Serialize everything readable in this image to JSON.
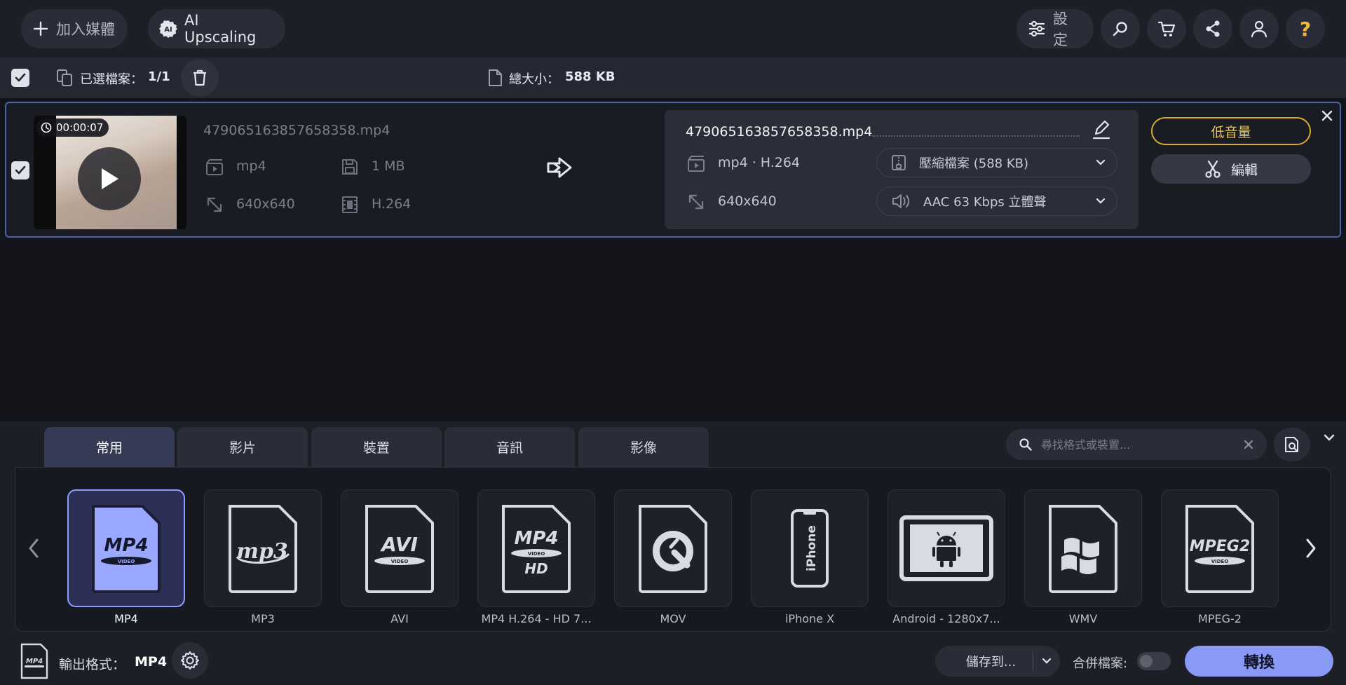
{
  "topbar": {
    "add_media": "加入媒體",
    "ai_upscaling": "AI Upscaling",
    "ai_badge": "AI",
    "settings": "設定",
    "help_glyph": "?"
  },
  "selection": {
    "label": "已選檔案：",
    "count": "1/1",
    "total_label": "總大小：",
    "total_value": "588 KB"
  },
  "file": {
    "duration": "00:00:07",
    "name": "479065163857658358.mp4",
    "format": "mp4",
    "size": "1 MB",
    "resolution": "640x640",
    "codec": "H.264"
  },
  "output": {
    "name": "479065163857658358.mp4",
    "format": "mp4 · H.264",
    "resolution": "640x640",
    "compress": "壓縮檔案 (588 KB)",
    "audio": "AAC 63 Kbps 立體聲",
    "low_volume": "低音量",
    "edit": "編輯"
  },
  "tabs": [
    {
      "label": "常用"
    },
    {
      "label": "影片"
    },
    {
      "label": "裝置"
    },
    {
      "label": "音訊"
    },
    {
      "label": "影像"
    }
  ],
  "search": {
    "placeholder": "尋找格式或裝置..."
  },
  "formats": [
    {
      "label": "MP4",
      "icon": "MP4",
      "sub": "VIDEO"
    },
    {
      "label": "MP3",
      "icon": "mp3"
    },
    {
      "label": "AVI",
      "icon": "AVI",
      "sub": "VIDEO"
    },
    {
      "label": "MP4 H.264 - HD 7...",
      "icon": "MP4",
      "sub": "VIDEO",
      "extra": "HD"
    },
    {
      "label": "MOV"
    },
    {
      "label": "iPhone X",
      "icon": "iPhone"
    },
    {
      "label": "Android - 1280x7..."
    },
    {
      "label": "WMV"
    },
    {
      "label": "MPEG-2",
      "icon": "MPEG2",
      "sub": "VIDEO"
    }
  ],
  "bottombar": {
    "output_label": "輸出格式：",
    "output_value": "MP4",
    "mini_icon": "MP4",
    "save_to": "儲存到...",
    "merge": "合併檔案:",
    "convert": "轉換"
  },
  "colors": {
    "accent": "#8a99f5",
    "warning": "#d9a92b",
    "selection_border": "#4d63a8"
  }
}
